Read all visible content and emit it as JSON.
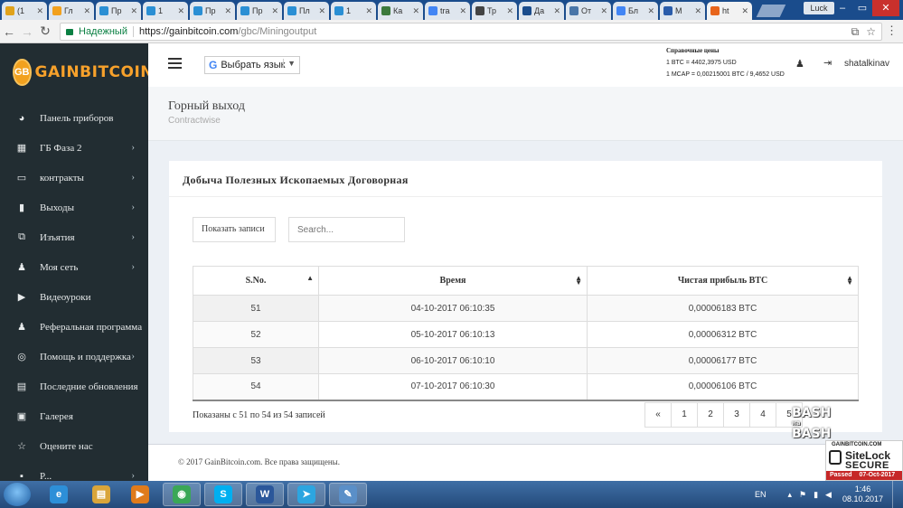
{
  "browser": {
    "tabs": [
      {
        "label": "(1",
        "color": "#e0a21b"
      },
      {
        "label": "Гл",
        "color": "#f2a11e"
      },
      {
        "label": "Пр",
        "color": "#2a8fd4"
      },
      {
        "label": "1",
        "color": "#2a8fd4"
      },
      {
        "label": "Пр",
        "color": "#2a8fd4"
      },
      {
        "label": "Пр",
        "color": "#2a8fd4"
      },
      {
        "label": "Пл",
        "color": "#2a8fd4"
      },
      {
        "label": "1",
        "color": "#2a8fd4"
      },
      {
        "label": "Ка",
        "color": "#3c7a3c"
      },
      {
        "label": "tra",
        "color": "#4285f4"
      },
      {
        "label": "Тр",
        "color": "#444444"
      },
      {
        "label": "Да",
        "color": "#1a4c8c"
      },
      {
        "label": "От",
        "color": "#4a76a8"
      },
      {
        "label": "Бл",
        "color": "#4285f4"
      },
      {
        "label": "М",
        "color": "#2a5caa"
      },
      {
        "label": "ht",
        "color": "#e8651b",
        "active": true
      }
    ],
    "profile": "Luck",
    "secure_label": "Надежный",
    "url_host": "https://gainbitcoin.com",
    "url_path": "/gbc/Miningoutput"
  },
  "brand": {
    "badge": "GB",
    "name": "GAINBITCOIN",
    "color": "#f7a12b"
  },
  "sidebar": {
    "items": [
      {
        "label": "Панель приборов",
        "icon": "dashboard-icon",
        "glyph": "◕",
        "chevron": false
      },
      {
        "label": "ГБ Фаза 2",
        "icon": "grid-icon",
        "glyph": "▦",
        "chevron": true
      },
      {
        "label": "контракты",
        "icon": "contract-icon",
        "glyph": "▭",
        "chevron": true
      },
      {
        "label": "Выходы",
        "icon": "briefcase-icon",
        "glyph": "▮",
        "chevron": true
      },
      {
        "label": "Изъятия",
        "icon": "withdraw-icon",
        "glyph": "⧉",
        "chevron": true
      },
      {
        "label": "Моя сеть",
        "icon": "network-icon",
        "glyph": "♟",
        "chevron": true
      },
      {
        "label": "Видеоуроки",
        "icon": "play-icon",
        "glyph": "▶",
        "chevron": false
      },
      {
        "label": "Реферальная программа",
        "icon": "users-icon",
        "glyph": "♟",
        "chevron": false
      },
      {
        "label": "Помощь и поддержка",
        "icon": "support-icon",
        "glyph": "◎",
        "chevron": true
      },
      {
        "label": "Последние обновления",
        "icon": "news-icon",
        "glyph": "▤",
        "chevron": false
      },
      {
        "label": "Галерея",
        "icon": "gallery-icon",
        "glyph": "▣",
        "chevron": false
      },
      {
        "label": "Оцените нас",
        "icon": "star-icon",
        "glyph": "☆",
        "chevron": false
      },
      {
        "label": "P...",
        "icon": "more-icon",
        "glyph": "▪",
        "chevron": true
      }
    ]
  },
  "header": {
    "translate_label": "Выбрать язык",
    "prices_heading": "Справочные цены",
    "price_btc": "1 BTC = 4402,3975 USD",
    "price_mcap": "1 MCAP = 0,00215001 BTC / 9,4652 USD",
    "username": "shatalkinav"
  },
  "page": {
    "title": "Горный выход",
    "subtitle": "Contractwise"
  },
  "box": {
    "title": "Добыча Полезных Ископаемых Договорная",
    "length_label": "Показать записи",
    "search_placeholder": "Search...",
    "columns": [
      "S.No.",
      "Время",
      "Чистая прибыль BTC"
    ],
    "rows": [
      [
        "51",
        "04-10-2017 06:10:35",
        "0,00006183 BTC"
      ],
      [
        "52",
        "05-10-2017 06:10:13",
        "0,00006312 BTC"
      ],
      [
        "53",
        "06-10-2017 06:10:10",
        "0,00006177 BTC"
      ],
      [
        "54",
        "07-10-2017 06:10:30",
        "0,00006106 BTC"
      ]
    ],
    "info": "Показаны с 51 по 54 из 54 записей",
    "pager": [
      "«",
      "1",
      "2",
      "3",
      "4",
      "5"
    ]
  },
  "footer": {
    "text": "© 2017 GainBitcoin.com. Все права защищены."
  },
  "watermark": {
    "line1": "BASH",
    "line2": "на",
    "line3": "BASH"
  },
  "sitelock": {
    "site": "GAINBITCOIN.COM",
    "name": "SiteLock",
    "secure": "SECURE",
    "passed": "Passed",
    "date": "07-Oct-2017"
  },
  "taskbar": {
    "apps": [
      {
        "name": "ie-icon",
        "glyph": "e",
        "color": "#2d8fd8"
      },
      {
        "name": "explorer-icon",
        "glyph": "▤",
        "color": "#d9a53a"
      },
      {
        "name": "media-icon",
        "glyph": "▶",
        "color": "#e07b1b"
      },
      {
        "name": "chrome-icon",
        "glyph": "◉",
        "color": "#3aa757",
        "open": true
      },
      {
        "name": "skype-icon",
        "glyph": "S",
        "color": "#00aff0",
        "open": true
      },
      {
        "name": "word-icon",
        "glyph": "W",
        "color": "#2b579a",
        "open": true
      },
      {
        "name": "telegram-icon",
        "glyph": "➤",
        "color": "#2ca5e0",
        "open": true
      },
      {
        "name": "paint-icon",
        "glyph": "✎",
        "color": "#5a8fc8",
        "open": true
      }
    ],
    "lang": "EN",
    "time": "1:46",
    "date": "08.10.2017"
  }
}
